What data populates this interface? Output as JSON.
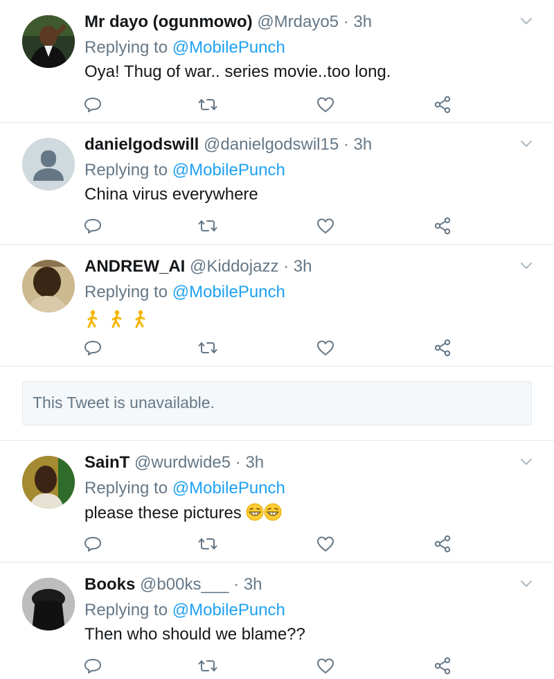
{
  "tweets": [
    {
      "name": "Mr dayo (ogunmowo)",
      "handle": "@Mrdayo5",
      "time": "3h",
      "replying_prefix": "Replying to",
      "replying_to": "@MobilePunch",
      "text": "Oya! Thug of war.. series movie..too long.",
      "avatar": "photo-avatar"
    },
    {
      "name": "danielgodswill",
      "handle": "@danielgodswil15",
      "time": "3h",
      "replying_prefix": "Replying to",
      "replying_to": "@MobilePunch",
      "text": "China virus everywhere",
      "avatar": "default-avatar"
    },
    {
      "name": "ANDREW_AI",
      "handle": "@Kiddojazz",
      "time": "3h",
      "replying_prefix": "Replying to",
      "replying_to": "@MobilePunch",
      "text": "",
      "emojis": [
        "person-walking-emoji",
        "person-walking-emoji",
        "person-walking-emoji"
      ],
      "avatar": "photo-avatar"
    },
    {
      "name": "SainT",
      "handle": "@wurdwide5",
      "time": "3h",
      "replying_prefix": "Replying to",
      "replying_to": "@MobilePunch",
      "text": "please these pictures",
      "emojis": [
        "grinning-face-emoji",
        "grinning-face-emoji"
      ],
      "avatar": "photo-avatar"
    },
    {
      "name": "Books",
      "handle": "@b00ks___",
      "time": "3h",
      "replying_prefix": "Replying to",
      "replying_to": "@MobilePunch",
      "text": "Then who should we blame??",
      "avatar": "photo-avatar"
    }
  ],
  "unavailable_notice": "This Tweet is unavailable.",
  "separator": "·",
  "icons": [
    "reply-icon",
    "retweet-icon",
    "like-icon",
    "share-icon",
    "chevron-down-icon"
  ],
  "colors": {
    "mention": "#1da1f2",
    "secondary_text": "#657786",
    "primary_text": "#14171a",
    "divider": "#e1e8ed",
    "notice_bg": "#f5f8fa"
  }
}
